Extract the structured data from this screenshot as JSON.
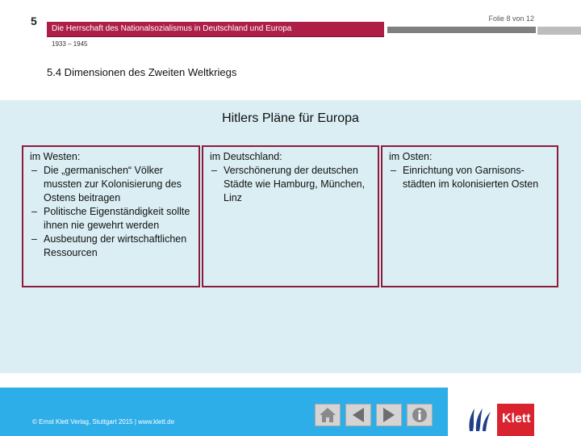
{
  "header": {
    "chapter_number": "5",
    "slide_counter": "Folie 8 von 12",
    "title": "Die Herrschaft des Nationalsozialismus in Deutschland und Europa",
    "dates": "1933 – 1945"
  },
  "section": {
    "title": "5.4 Dimensionen des Zweiten Weltkriegs"
  },
  "main": {
    "heading": "Hitlers Pläne für Europa",
    "columns": [
      {
        "title": "im Westen:",
        "items": [
          "Die „germanischen“ Völker mussten zur Kolonisierung des Ostens beitragen",
          "Politische Eigenständigkeit sollte ihnen nie gewehrt werden",
          "Ausbeutung der wirtschaftlichen Ressourcen"
        ]
      },
      {
        "title": "im Deutschland:",
        "items": [
          "Verschönerung der deutschen Städte wie Hamburg, München, Linz"
        ]
      },
      {
        "title": "im Osten:",
        "items": [
          "Einrichtung von Garnisons­städten im kolonisierten Osten"
        ]
      }
    ]
  },
  "footer": {
    "copyright": "© Ernst Klett Verlag, Stuttgart 2015 | www.klett.de",
    "nav_icons": [
      "home-icon",
      "prev-arrow-icon",
      "next-arrow-icon",
      "info-icon"
    ],
    "logo_text": "Klett"
  },
  "colors": {
    "accent": "#ad1f47",
    "content_bg": "#daeef3",
    "footer_blue": "#2daee8",
    "logo_red": "#d9232e"
  }
}
